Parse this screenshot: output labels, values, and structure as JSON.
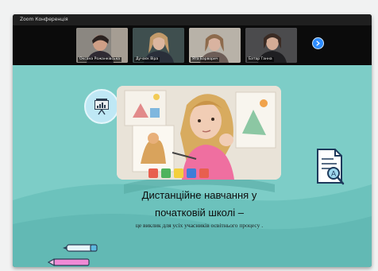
{
  "window": {
    "title": "Zoom Конференція"
  },
  "participants": [
    {
      "name": "Оксана Рожанківська"
    },
    {
      "name": "Дучаєк Віра"
    },
    {
      "name": "Ята Барворич"
    },
    {
      "name": "Батар Ганна"
    }
  ],
  "navigation": {
    "next_icon": "chevron-right-icon"
  },
  "slide": {
    "title_line1": "Дистанційне навчання у",
    "title_line2": "початковій школі –",
    "subtitle": "це виклик для усіх учасників освітнього процесу ."
  },
  "colors": {
    "slide_background": "#7dcdc7",
    "slide_wave": "#5fb9b3",
    "accent_blue": "#2d8cff",
    "window_background": "#000000"
  }
}
